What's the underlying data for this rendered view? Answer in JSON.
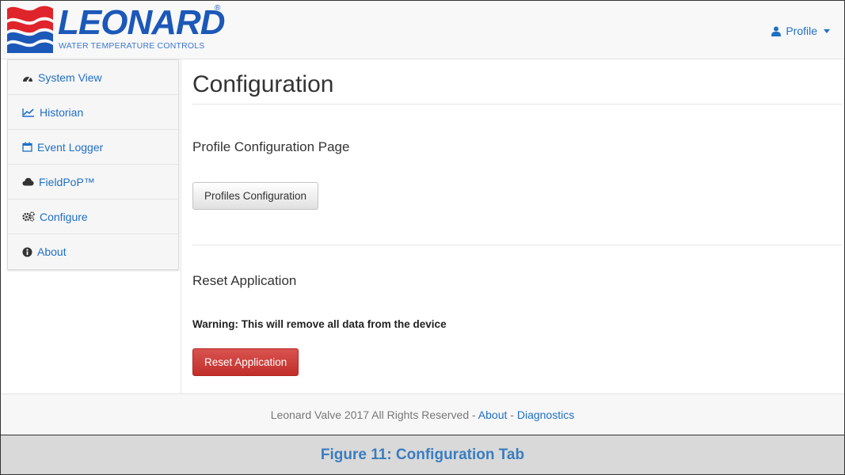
{
  "header": {
    "logo_word": "LEONARD",
    "logo_reg": "®",
    "logo_tagline": "WATER TEMPERATURE CONTROLS",
    "profile_label": "Profile"
  },
  "sidebar": {
    "items": [
      {
        "label": "System View",
        "icon": "dashboard-icon"
      },
      {
        "label": "Historian",
        "icon": "line-chart-icon"
      },
      {
        "label": "Event Logger",
        "icon": "calendar-icon"
      },
      {
        "label": "FieldPoP™",
        "icon": "cloud-icon"
      },
      {
        "label": "Configure",
        "icon": "gears-icon"
      },
      {
        "label": "About",
        "icon": "info-circle-icon"
      }
    ]
  },
  "main": {
    "title": "Configuration",
    "profile_section": {
      "heading": "Profile Configuration Page",
      "button_label": "Profiles Configuration"
    },
    "reset_section": {
      "heading": "Reset Application",
      "warning": "Warning: This will remove all data from the device",
      "button_label": "Reset Application"
    }
  },
  "footer": {
    "text": "Leonard Valve 2017 All Rights Reserved - ",
    "about_link": "About",
    "separator": " - ",
    "diagnostics_link": "Diagnostics"
  },
  "caption": "Figure 11: Configuration Tab",
  "colors": {
    "link": "#1f6fc5",
    "danger": "#c9302c",
    "brand_blue": "#1b58b8",
    "brand_red": "#e0242b",
    "caption_text": "#3a7dbf"
  }
}
